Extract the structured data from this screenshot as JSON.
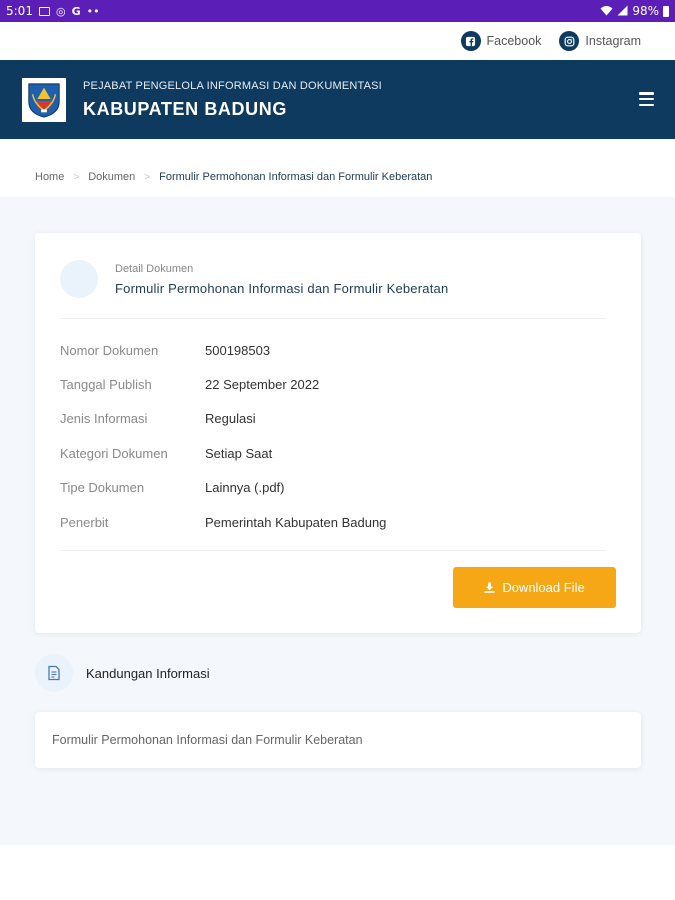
{
  "statusbar": {
    "time": "5:01",
    "app_glyph": "G",
    "battery": "98%"
  },
  "social": {
    "facebook_label": "Facebook",
    "instagram_label": "Instagram"
  },
  "header": {
    "subtitle": "PEJABAT PENGELOLA INFORMASI DAN DOKUMENTASI",
    "title": "KABUPATEN BADUNG"
  },
  "breadcrumb": {
    "items": [
      "Home",
      "Dokumen"
    ],
    "current": "Formulir Permohonan Informasi dan Formulir Keberatan"
  },
  "detail": {
    "label": "Detail Dokumen",
    "title": "Formulir Permohonan Informasi dan Formulir Keberatan",
    "rows": [
      {
        "key": "Nomor Dokumen",
        "value": "500198503"
      },
      {
        "key": "Tanggal Publish",
        "value": "22 September 2022"
      },
      {
        "key": "Jenis Informasi",
        "value": "Regulasi"
      },
      {
        "key": "Kategori Dokumen",
        "value": "Setiap Saat"
      },
      {
        "key": "Tipe Dokumen",
        "value": "Lainnya (.pdf)"
      },
      {
        "key": "Penerbit",
        "value": "Pemerintah Kabupaten Badung"
      }
    ],
    "download_label": "Download File"
  },
  "kandungan": {
    "title": "Kandungan Informasi",
    "content": "Formulir Permohonan Informasi dan Formulir Keberatan"
  },
  "colors": {
    "primary": "#0e3a5f",
    "accent": "#f5a716",
    "statusbar": "#5b1fb8"
  }
}
